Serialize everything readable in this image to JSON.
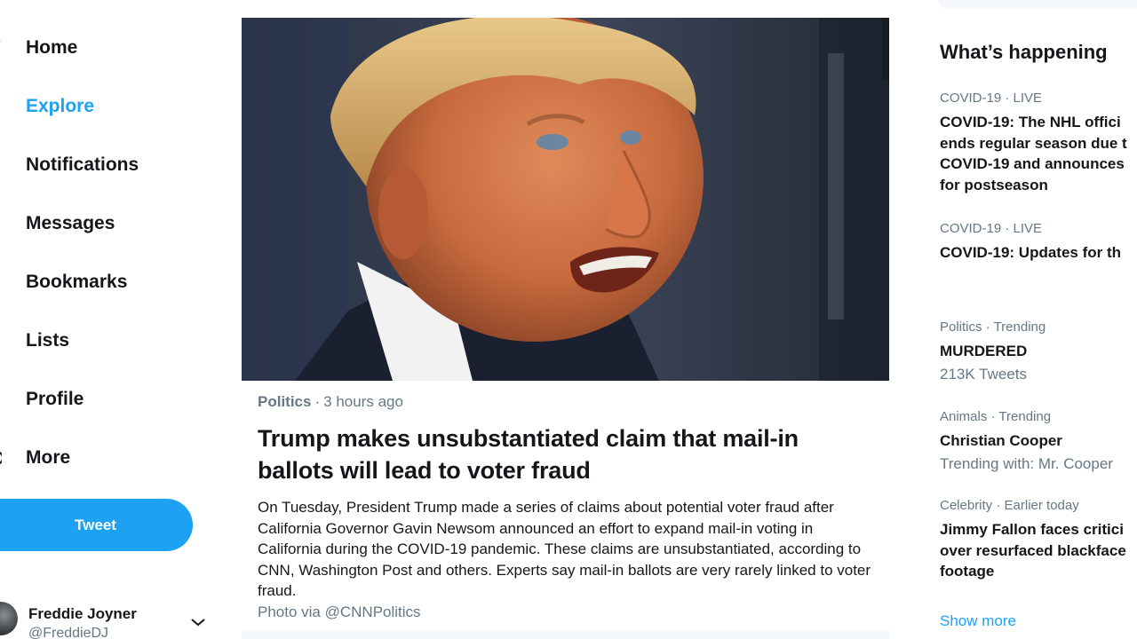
{
  "nav": {
    "items": [
      {
        "label": "Home"
      },
      {
        "label": "Explore"
      },
      {
        "label": "Notifications"
      },
      {
        "label": "Messages"
      },
      {
        "label": "Bookmarks"
      },
      {
        "label": "Lists"
      },
      {
        "label": "Profile"
      },
      {
        "label": "More"
      }
    ],
    "active": "Explore",
    "tweet_button": "Tweet",
    "account": {
      "name": "Freddie Joyner",
      "handle": "@FreddieDJ"
    }
  },
  "article": {
    "category": "Politics",
    "separator": "·",
    "time": "3 hours ago",
    "headline": "Trump makes unsubstantiated claim that mail-in ballots will lead to voter fraud",
    "body": "On Tuesday, President Trump made a series of claims about potential voter fraud after California Governor Gavin Newsom announced an effort to expand mail-in voting in California during the COVID-19 pandemic. These claims are unsubstantiated, according to CNN, Washington Post and others. Experts say mail-in ballots are very rarely linked to voter fraud.",
    "credit": "Photo via @CNNPolitics"
  },
  "sidebar": {
    "title": "What’s happening",
    "trends": [
      {
        "meta": "COVID-19 · LIVE",
        "title_lines": [
          "COVID-19: The NHL offici",
          "ends regular season due t",
          "COVID-19 and announces",
          "for postseason"
        ],
        "sub": ""
      },
      {
        "meta": "COVID-19 · LIVE",
        "title_lines": [
          "COVID-19: Updates for th"
        ],
        "sub": ""
      },
      {
        "meta": "Politics · Trending",
        "title_lines": [
          "MURDERED"
        ],
        "sub": "213K Tweets"
      },
      {
        "meta": "Animals · Trending",
        "title_lines": [
          "Christian Cooper"
        ],
        "sub": "Trending with: Mr. Cooper"
      },
      {
        "meta": "Celebrity · Earlier today",
        "title_lines": [
          "Jimmy Fallon faces critici",
          "over resurfaced blackface",
          "footage"
        ],
        "sub": ""
      }
    ],
    "show_more": "Show more"
  },
  "colors": {
    "accent": "#1da1f2",
    "text_primary": "#14171a",
    "text_secondary": "#657786"
  }
}
